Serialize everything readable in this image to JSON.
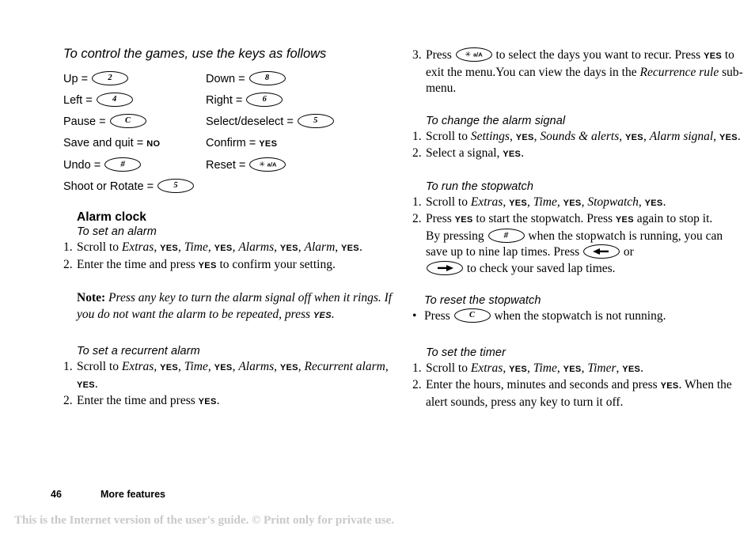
{
  "left_column": {
    "games_heading": "To control the games, use the keys as follows",
    "key_rows": [
      {
        "left_label": "Up =",
        "left_key": "2",
        "left_key_type": "char",
        "right_label": "Down =",
        "right_key": "8",
        "right_key_type": "char"
      },
      {
        "left_label": "Left =",
        "left_key": "4",
        "left_key_type": "char",
        "right_label": "Right =",
        "right_key": "6",
        "right_key_type": "char"
      },
      {
        "left_label": "Pause =",
        "left_key": "C",
        "left_key_type": "char",
        "right_label": "Select/deselect =",
        "right_key": "5",
        "right_key_type": "char"
      },
      {
        "left_label": "Save and quit =",
        "left_key": "NO",
        "left_key_type": "softkey",
        "right_label": "Confirm =",
        "right_key": "YES",
        "right_key_type": "softkey"
      },
      {
        "left_label": "Undo =",
        "left_key": "#",
        "left_key_type": "symbol",
        "right_label": "Reset =",
        "right_key": "a/A",
        "right_key_type": "star"
      },
      {
        "left_label": "Shoot or Rotate =",
        "left_key": "5",
        "left_key_type": "char",
        "right_label": "",
        "right_key": "",
        "right_key_type": "none"
      }
    ],
    "alarm_clock_heading": "Alarm clock",
    "set_alarm_heading": "To set an alarm",
    "set_alarm_steps": {
      "step1_pre": "Scroll to ",
      "step1_m1": "Extras",
      "step1_sep1": ", ",
      "step1_k1": "YES",
      "step1_sep2": ", ",
      "step1_m2": "Time",
      "step1_sep3": ", ",
      "step1_k2": "YES",
      "step1_sep4": ", ",
      "step1_m3": "Alarms",
      "step1_sep5": ", ",
      "step1_k3": "YES",
      "step1_sep6": ", ",
      "step1_m4": "Alarm",
      "step1_sep7": ", ",
      "step1_k4": "YES",
      "step1_end": ".",
      "step2_pre": "Enter the time and press ",
      "step2_k1": "YES",
      "step2_post": " to confirm your setting."
    },
    "note": {
      "lead": "Note:",
      "body_1": " Press any key to turn the alarm signal off when it rings. If you do not want the alarm to be repeated, press ",
      "key": "YES",
      "body_2": "."
    },
    "recurrent_heading": "To set a recurrent alarm",
    "recurrent_steps": {
      "step1_pre": "Scroll to ",
      "step1_m1": "Extras",
      "step1_sep1": ", ",
      "step1_k1": "YES",
      "step1_sep2": ", ",
      "step1_m2": "Time",
      "step1_sep3": ", ",
      "step1_k2": "YES",
      "step1_sep4": ", ",
      "step1_m3": "Alarms",
      "step1_sep5": ", ",
      "step1_k3": "YES",
      "step1_sep6": ", ",
      "step1_m4": "Recurrent alarm",
      "step1_sep7": ", ",
      "step1_k4": "YES",
      "step1_end": ".",
      "step2_pre": "Enter the time and press ",
      "step2_k1": "YES",
      "step2_post": "."
    },
    "numbers": {
      "one": "1.",
      "two": "2.",
      "three": "3.",
      "bullet": "•"
    }
  },
  "right_column": {
    "recur_step": {
      "num": "3.",
      "pre": "Press ",
      "key_label": "a/A",
      "mid": " to select the days you want to recur. Press ",
      "key2": "YES",
      "mid2": " to exit the menu.You can view the days in the ",
      "italic": "Recurrence rule",
      "post": " sub-menu."
    },
    "alarm_signal_heading": "To change the alarm signal",
    "alarm_signal_steps": {
      "step1_pre": "Scroll to ",
      "step1_m1": "Settings",
      "step1_sep1": ", ",
      "step1_k1": "YES",
      "step1_sep2": ", ",
      "step1_m2": "Sounds & alerts",
      "step1_sep3": ", ",
      "step1_k2": "YES",
      "step1_sep4": ", ",
      "step1_m3": "Alarm signal",
      "step1_sep5": ", ",
      "step1_k3": "YES",
      "step1_end": ".",
      "step2_pre": "Select a signal, ",
      "step2_k1": "YES",
      "step2_post": "."
    },
    "stopwatch_heading": "To run the stopwatch",
    "stopwatch_steps": {
      "step1_pre": "Scroll to ",
      "step1_m1": "Extras",
      "step1_sep1": ", ",
      "step1_k1": "YES",
      "step1_sep2": ", ",
      "step1_m2": "Time",
      "step1_sep3": ", ",
      "step1_k2": "YES",
      "step1_sep4": ", ",
      "step1_m3": "Stopwatch",
      "step1_sep5": ", ",
      "step1_k3": "YES",
      "step1_end": ".",
      "step2_a": "Press ",
      "step2_k1": "YES",
      "step2_b": " to start the stopwatch. Press ",
      "step2_k2": "YES",
      "step2_c": " again to stop it.",
      "step2_d": "By pressing ",
      "step2_key_hash": "#",
      "step2_e": " when the stopwatch is running, you can save up to nine lap times. Press ",
      "step2_key_left": "left-arrow",
      "step2_f": " or ",
      "step2_key_right": "right-arrow",
      "step2_g": " to check your saved lap times."
    },
    "reset_stopwatch_heading": "To reset the stopwatch",
    "reset_stopwatch_step": {
      "bullet": "•",
      "pre": "Press ",
      "key": "C",
      "post": " when the stopwatch is not running."
    },
    "timer_heading": "To set the timer",
    "timer_steps": {
      "step1_pre": "Scroll to ",
      "step1_m1": "Extras",
      "step1_sep1": ", ",
      "step1_k1": "YES",
      "step1_sep2": ", ",
      "step1_m2": "Time",
      "step1_sep3": ", ",
      "step1_k2": "YES",
      "step1_sep4": ", ",
      "step1_m3": "Timer",
      "step1_sep5": ", ",
      "step1_k3": "YES",
      "step1_end": ".",
      "step2_pre": "Enter the hours, minutes and seconds and press ",
      "step2_k1": "YES",
      "step2_post": ". When the alert sounds, press any key to turn it off."
    },
    "numbers": {
      "one": "1.",
      "two": "2.",
      "three": "3."
    }
  },
  "footer": {
    "page_number": "46",
    "section": "More features",
    "disclaimer": "This is the Internet version of the user's guide. © Print only for private use."
  },
  "colors": {
    "text": "#000000",
    "disclaimer": "#c9c9c9",
    "background": "#ffffff"
  }
}
